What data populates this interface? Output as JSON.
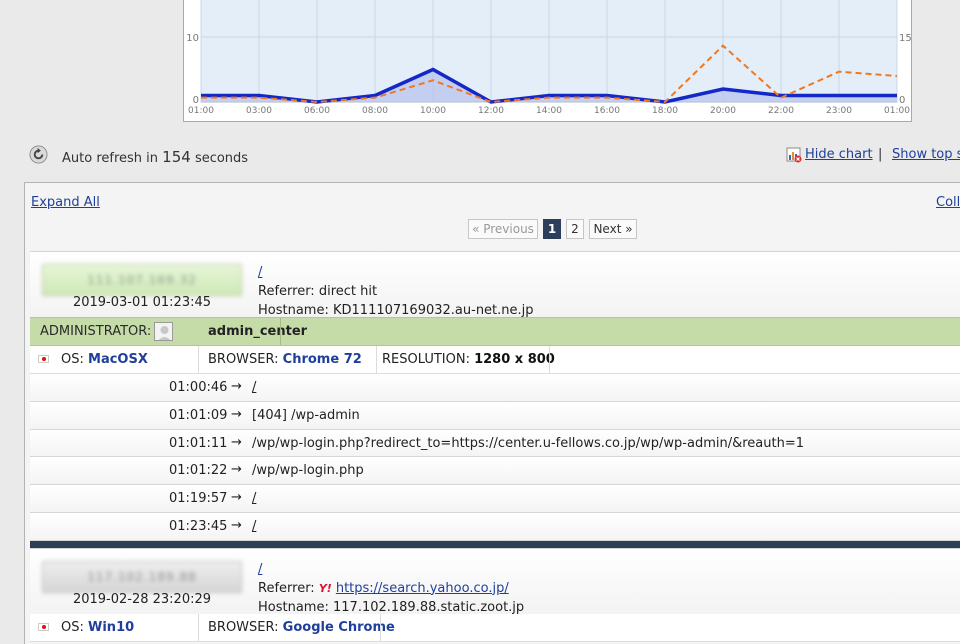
{
  "chart_data": {
    "type": "line",
    "categories": [
      "01:00",
      "03:00",
      "06:00",
      "08:00",
      "10:00",
      "12:00",
      "14:00",
      "16:00",
      "18:00",
      "20:00",
      "22:00",
      "23:00",
      "01:00"
    ],
    "y_left_ticks": [
      "10",
      "0"
    ],
    "y_right_ticks": [
      "15",
      "0"
    ],
    "series": [
      {
        "color": "#1428c8",
        "style": "solid",
        "axis": "left",
        "values": [
          1,
          1,
          0,
          1,
          5,
          0,
          1,
          1,
          0,
          2,
          1,
          1,
          1
        ]
      },
      {
        "color": "#f07820",
        "style": "dashed",
        "axis": "right",
        "values": [
          1,
          1,
          0,
          1,
          5,
          0,
          1,
          1,
          0,
          13,
          1,
          7,
          6
        ]
      }
    ],
    "ylim_left": [
      0,
      16
    ],
    "ylim_right": [
      0,
      24
    ],
    "colors": {
      "plot_bg": "#e4eef8",
      "grid": "#c9d7e6",
      "fill": "#b9c3ee"
    }
  },
  "toolbar": {
    "auto_refresh_prefix": "Auto refresh in",
    "auto_refresh_seconds": "154",
    "auto_refresh_suffix": "seconds",
    "hide_chart": "Hide chart",
    "separator": "|",
    "show_top": "Show top s"
  },
  "panel": {
    "expand_all": "Expand All",
    "collapse_all": "Coll",
    "pager": {
      "prev": "« Previous",
      "current": "1",
      "page2": "2",
      "next": "Next »"
    }
  },
  "visits": [
    {
      "ip": "111.107.169.32",
      "time": "2019-03-01 01:23:45",
      "path": "/",
      "referrer_label": "Referrer:",
      "referrer": "direct hit",
      "hostname_label": "Hostname:",
      "hostname": "KD111107169032.au-net.ne.jp",
      "admin_label": "ADMINISTRATOR:",
      "admin_name": "admin_center",
      "os_label": "OS:",
      "os": "MacOSX",
      "browser_label": "BROWSER:",
      "browser": "Chrome 72",
      "resolution_label": "RESOLUTION:",
      "resolution": "1280 x 800",
      "actions": [
        {
          "time": "01:00:46",
          "url": "/",
          "link": true
        },
        {
          "time": "01:01:09",
          "url": "[404] /wp-admin",
          "link": false
        },
        {
          "time": "01:01:11",
          "url": "/wp/wp-login.php?redirect_to=https://center.u-fellows.co.jp/wp/wp-admin/&reauth=1",
          "link": false
        },
        {
          "time": "01:01:22",
          "url": "/wp/wp-login.php",
          "link": false
        },
        {
          "time": "01:19:57",
          "url": "/",
          "link": true
        },
        {
          "time": "01:23:45",
          "url": "/",
          "link": true
        }
      ]
    },
    {
      "ip": "117.102.189.88",
      "time": "2019-02-28 23:20:29",
      "path": "/",
      "referrer_label": "Referrer:",
      "referrer_icon": "Y!",
      "referrer": "https://search.yahoo.co.jp/",
      "hostname_label": "Hostname:",
      "hostname": "117.102.189.88.static.zoot.jp",
      "os_label": "OS:",
      "os": "Win10",
      "browser_label": "BROWSER:",
      "browser": "Google Chrome"
    }
  ],
  "arrow": "→"
}
